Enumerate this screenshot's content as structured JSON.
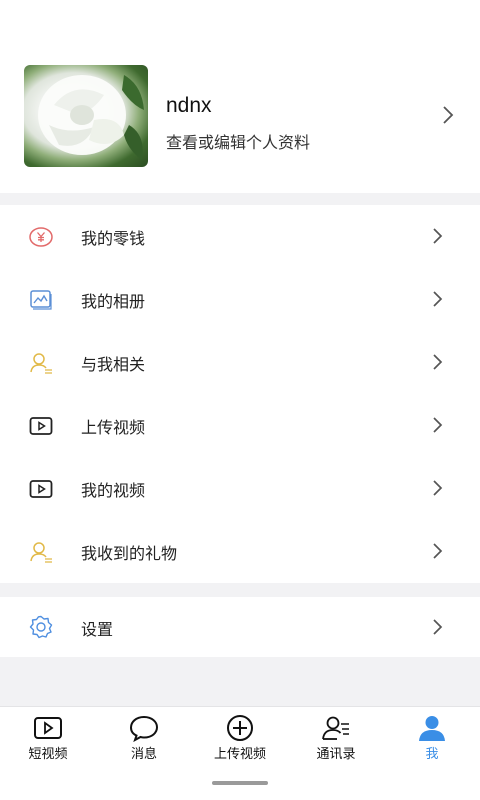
{
  "profile": {
    "username": "ndnx",
    "subtitle": "查看或编辑个人资料"
  },
  "menu": {
    "items": [
      {
        "label": "我的零钱",
        "icon": "wallet-yen-icon"
      },
      {
        "label": "我的相册",
        "icon": "album-icon"
      },
      {
        "label": "与我相关",
        "icon": "user-related-icon"
      },
      {
        "label": "上传视频",
        "icon": "video-play-icon"
      },
      {
        "label": "我的视频",
        "icon": "video-play-icon"
      },
      {
        "label": "我收到的礼物",
        "icon": "user-gift-icon"
      }
    ]
  },
  "settings": {
    "label": "设置",
    "icon": "gear-icon"
  },
  "tabbar": {
    "tabs": [
      {
        "label": "短视频",
        "icon": "video-play-icon"
      },
      {
        "label": "消息",
        "icon": "message-bubble-icon"
      },
      {
        "label": "上传视频",
        "icon": "plus-circle-icon"
      },
      {
        "label": "通讯录",
        "icon": "contacts-icon"
      },
      {
        "label": "我",
        "icon": "person-icon"
      }
    ],
    "active_index": 4
  },
  "colors": {
    "accent": "#3a8ee6",
    "yen": "#e26a6a",
    "album": "#5b8fd6",
    "user_gold": "#e1b947",
    "gear": "#4f8fe0"
  }
}
